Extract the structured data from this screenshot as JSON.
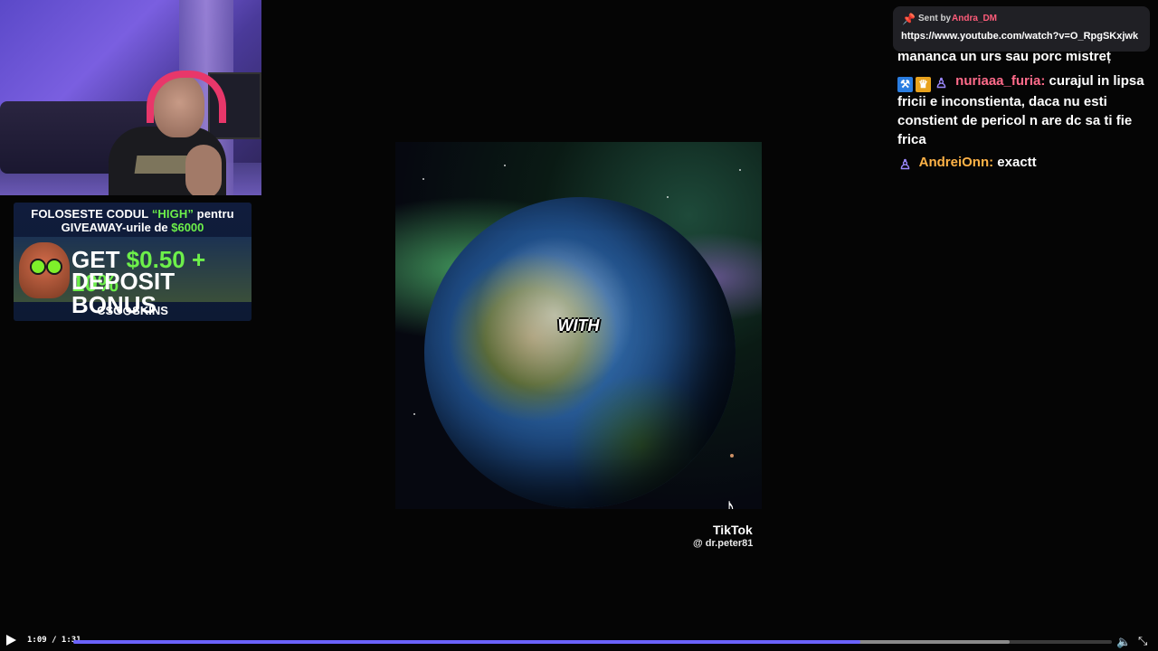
{
  "sponsor": {
    "line1_pre": "FOLOSESTE CODUL ",
    "line1_code": "“HIGH”",
    "line1_post": " pentru",
    "line2_pre": "GIVEAWAY-urile de ",
    "line2_amount": "$6000",
    "get_pre": "GET ",
    "get_value": "$0.50 + 10%",
    "deposit": "DEPOSIT BONUS",
    "brand": "CSG⊙SKINS"
  },
  "video": {
    "caption": "WITH",
    "platform": "TikTok",
    "username": "@ dr.peter81"
  },
  "chat": {
    "messages": [
      {
        "text": "mananca un urs sau porc mistreț"
      },
      {
        "badges": [
          "mod",
          "crown",
          "sub"
        ],
        "user": "nuriaaa_furia:",
        "text": "curajul in lipsa fricii e inconstienta, daca nu esti constient de pericol n are dc sa ti fie frica"
      },
      {
        "badges": [
          "sub"
        ],
        "user": "AndreiOnn:",
        "text": "exactt"
      }
    ]
  },
  "popup": {
    "sent_label": "Sent by",
    "sender": "Andra_DM",
    "url": "https://www.youtube.com/watch?v=O_RpgSKxjwk"
  },
  "player": {
    "time": "1:09 / 1:31",
    "progress_fraction": 0.758,
    "buffer_fraction": 0.902
  },
  "colors": {
    "accent": "#6b63ff",
    "highlight_green": "#6df04a",
    "chat_user1": "#ff6b8a",
    "chat_user2": "#ffb347"
  },
  "icons": {
    "play": "play-icon",
    "volume": "volume-icon",
    "fullscreen": "fullscreen-icon",
    "pin": "pin-icon",
    "tiktok": "tiktok-icon"
  }
}
